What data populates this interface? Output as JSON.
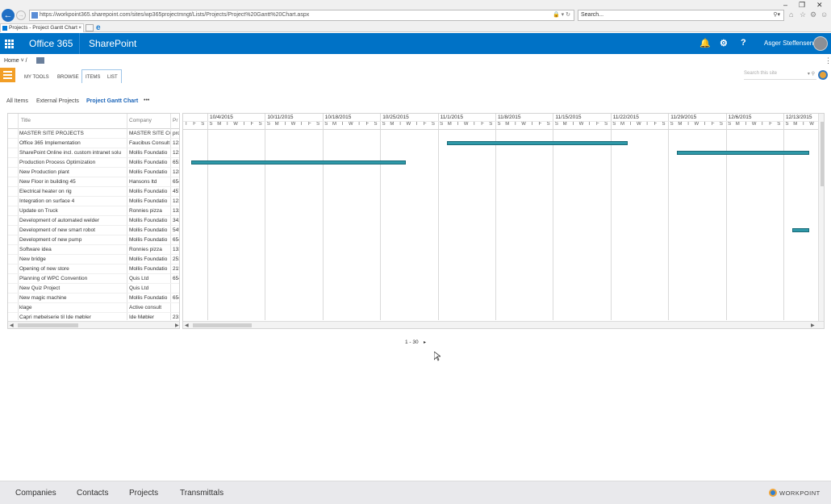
{
  "browser": {
    "address": "https://workpoint365.sharepoint.com/sites/wp365projectmngt/Lists/Projects/Project%20Gantt%20Chart.aspx",
    "search_placeholder": "Search...",
    "tab_title": "Projects - Project Gantt Chart"
  },
  "suite": {
    "brand": "Office 365",
    "app": "SharePoint",
    "user": "Asger Steffensen"
  },
  "breadcrumb": {
    "home": "Home"
  },
  "ribbon": {
    "tabs": [
      "MY TOOLS",
      "BROWSE",
      "ITEMS",
      "LIST"
    ],
    "search_placeholder": "Search this site"
  },
  "views": {
    "all_items": "All Items",
    "external": "External Projects",
    "gantt": "Project Gantt Chart",
    "more": "•••"
  },
  "grid": {
    "headers": [
      "Title",
      "Company",
      "Pr"
    ],
    "rows": [
      {
        "title": "MASTER SITE PROJECTS",
        "company": "MASTER SITE CC",
        "p": "pro"
      },
      {
        "title": "Office 365 Implementation",
        "company": "Faucibus Consult",
        "p": "123"
      },
      {
        "title": "SharePoint Online incl. custom intranet solu",
        "company": "Mollis Foundatio",
        "p": "123"
      },
      {
        "title": "Production Process Optimization",
        "company": "Mollis Foundatio",
        "p": "653"
      },
      {
        "title": "New Production plant",
        "company": "Mollis Foundatio",
        "p": "128"
      },
      {
        "title": "New Floor in building 45",
        "company": "Hansons ltd",
        "p": "654"
      },
      {
        "title": "Electrical heater on rig",
        "company": "Mollis Foundatio",
        "p": "457"
      },
      {
        "title": "Integration on surface 4",
        "company": "Mollis Foundatio",
        "p": "123"
      },
      {
        "title": "Update on Truck",
        "company": "Ronnies pizza",
        "p": "132"
      },
      {
        "title": "Development of automated welder",
        "company": "Mollis Foundatio",
        "p": "342"
      },
      {
        "title": "Development of new smart robot",
        "company": "Mollis Foundatio",
        "p": "545"
      },
      {
        "title": "Development of new pump",
        "company": "Mollis Foundatio",
        "p": "654"
      },
      {
        "title": "Software idea",
        "company": "Ronnies pizza",
        "p": "133"
      },
      {
        "title": "New bridge",
        "company": "Mollis Foundatio",
        "p": "253"
      },
      {
        "title": "Opening of new store",
        "company": "Mollis Foundatio",
        "p": "215"
      },
      {
        "title": "Planning of WPC Convention",
        "company": "Quis Ltd",
        "p": "654"
      },
      {
        "title": "New Quiz Project",
        "company": "Quis Ltd",
        "p": ""
      },
      {
        "title": "New magic machine",
        "company": "Mollis Foundatio",
        "p": "654"
      },
      {
        "title": "klage",
        "company": "Active consult",
        "p": ""
      },
      {
        "title": "Capri møbelserie til Ide møbler",
        "company": "Ide Møbler",
        "p": "231"
      }
    ]
  },
  "gantt": {
    "weeks": [
      "10/4/2015",
      "10/11/2015",
      "10/18/2015",
      "10/25/2015",
      "11/1/2015",
      "11/8/2015",
      "11/15/2015",
      "11/22/2015",
      "11/29/2015",
      "12/6/2015",
      "12/13/2015"
    ],
    "day_letters": [
      "S",
      "M",
      "T",
      "W",
      "T",
      "F",
      "S"
    ],
    "lead_days": [
      "T",
      "F",
      "S"
    ],
    "bars": [
      {
        "row": 1,
        "start": "2015-11-02",
        "end": "2015-11-24"
      },
      {
        "row": 2,
        "start": "2015-11-30",
        "end": "2015-12-16"
      },
      {
        "row": 3,
        "start": "2015-10-01",
        "end": "2015-10-28"
      },
      {
        "row": 10,
        "start": "2015-12-14",
        "end": "2015-12-16"
      }
    ],
    "bar_color": "#2e98a8"
  },
  "paging": {
    "range": "1 - 30",
    "next": "▸"
  },
  "footer": {
    "links": [
      "Companies",
      "Contacts",
      "Projects",
      "Transmittals"
    ],
    "brand": "WORKPOINT"
  },
  "colors": {
    "suite": "#0072c6",
    "accent": "#f29e26"
  }
}
